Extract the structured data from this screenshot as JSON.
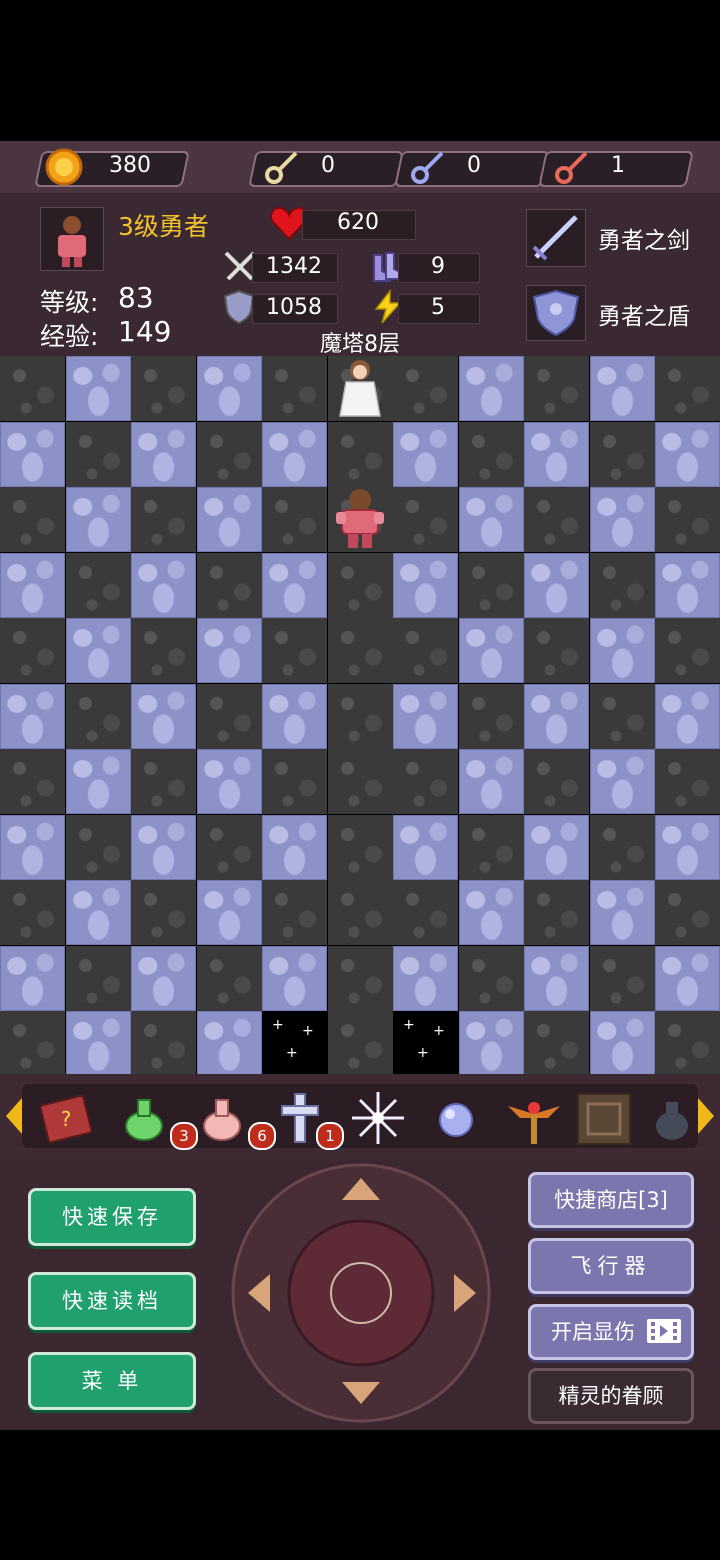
{
  "resources": {
    "gold": "380",
    "yellow_keys": "0",
    "blue_keys": "0",
    "red_keys": "1"
  },
  "hero": {
    "title": "3级勇者",
    "hp": "620",
    "attack": "1342",
    "defense": "1058",
    "magic_defense": "9",
    "speed": "5",
    "level_label": "等级:",
    "level": "83",
    "exp_label": "经验:",
    "exp": "149",
    "floor": "魔塔8层",
    "weapon": "勇者之剑",
    "armor": "勇者之盾"
  },
  "items": [
    {
      "name": "monster-manual",
      "count": ""
    },
    {
      "name": "green-potion",
      "count": "3"
    },
    {
      "name": "pink-potion",
      "count": "6"
    },
    {
      "name": "holy-cross",
      "count": "1"
    },
    {
      "name": "ice-magic",
      "count": ""
    },
    {
      "name": "orb",
      "count": ""
    },
    {
      "name": "winged-staff",
      "count": ""
    },
    {
      "name": "rune-tablet",
      "count": ""
    },
    {
      "name": "dark-vase",
      "count": ""
    }
  ],
  "buttons": {
    "quick_save": "快速保存",
    "quick_load": "快速读档",
    "menu": "菜 单",
    "shop": "快捷商店[3]",
    "fly": "飞行器",
    "damage": "开启显伤",
    "fairy": "精灵的眷顾"
  },
  "colors": {
    "hero_title": "#f2c22c",
    "green_button": "#1fa06c",
    "purple_button": "#7b76ad",
    "wall": "#8c92c8",
    "floor": "#3a3a3a"
  }
}
